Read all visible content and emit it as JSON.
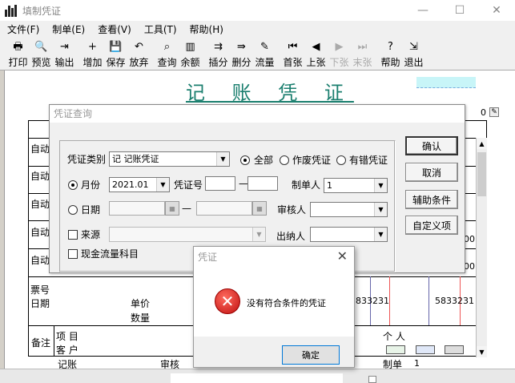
{
  "window": {
    "title": "填制凭证",
    "min": "—",
    "max": "☐",
    "close": "✕"
  },
  "menu": [
    "文件(F)",
    "制单(E)",
    "查看(V)",
    "工具(T)",
    "帮助(H)"
  ],
  "toolbar": [
    {
      "label": "打印",
      "icon": "printer-icon",
      "glyph": "🖶",
      "enabled": true
    },
    {
      "label": "预览",
      "icon": "preview-icon",
      "glyph": "🔍",
      "enabled": true
    },
    {
      "label": "输出",
      "icon": "export-icon",
      "glyph": "⇥",
      "enabled": true
    },
    {
      "label": "增加",
      "icon": "add-icon",
      "glyph": "+",
      "enabled": true
    },
    {
      "label": "保存",
      "icon": "save-icon",
      "glyph": "💾",
      "enabled": true
    },
    {
      "label": "放弃",
      "icon": "undo-icon",
      "glyph": "↶",
      "enabled": true
    },
    {
      "label": "查询",
      "icon": "binoculars-icon",
      "glyph": "⌕",
      "enabled": true
    },
    {
      "label": "余额",
      "icon": "balance-chart-icon",
      "glyph": "▥",
      "enabled": true
    },
    {
      "label": "插分",
      "icon": "insert-row-icon",
      "glyph": "⇉",
      "enabled": true
    },
    {
      "label": "删分",
      "icon": "delete-row-icon",
      "glyph": "⇛",
      "enabled": true
    },
    {
      "label": "流量",
      "icon": "cashflow-icon",
      "glyph": "✎",
      "enabled": true
    },
    {
      "label": "首张",
      "icon": "first-icon",
      "glyph": "⏮",
      "enabled": true
    },
    {
      "label": "上张",
      "icon": "prev-icon",
      "glyph": "◀",
      "enabled": true
    },
    {
      "label": "下张",
      "icon": "next-icon",
      "glyph": "▶",
      "enabled": false
    },
    {
      "label": "末张",
      "icon": "last-icon",
      "glyph": "⏭",
      "enabled": false
    },
    {
      "label": "帮助",
      "icon": "help-icon",
      "glyph": "?",
      "enabled": true
    },
    {
      "label": "退出",
      "icon": "exit-icon",
      "glyph": "⇲",
      "enabled": true
    }
  ],
  "voucher": {
    "title": "记 账 凭 证",
    "right_value": "0",
    "row_labels": [
      "自动",
      "自动",
      "自动",
      "自动",
      "自动"
    ],
    "row_values": [
      "00",
      "00"
    ],
    "ticket_no": "票号",
    "date": "日期",
    "unit_price": "单价",
    "quantity": "数量",
    "amount_debit": "5833231",
    "amount_credit": "5833231",
    "remark": "备注",
    "project": "项    目",
    "customer": "客    户",
    "person": "个    人",
    "bookkeeper": "记账",
    "auditor": "审核",
    "maker_label": "制单",
    "maker_value": "1"
  },
  "query_dialog": {
    "title": "凭证查询",
    "voucher_type_label": "凭证类别",
    "voucher_type_value": "记    记账凭证",
    "radio_all": "全部",
    "radio_void": "作废凭证",
    "radio_error": "有错凭证",
    "month_label": "月份",
    "month_value": "2021.01",
    "voucher_no_label": "凭证号",
    "dash": "—",
    "maker_label": "制单人",
    "maker_value": "1",
    "date_label": "日期",
    "reviewer_label": "审核人",
    "source_label": "来源",
    "cashier_label": "出纳人",
    "cashflow_label": "现金流量科目",
    "btn_ok": "确认",
    "btn_cancel": "取消",
    "btn_aux": "辅助条件",
    "btn_custom": "自定义项"
  },
  "message_box": {
    "title": "凭证",
    "message": "没有符合条件的凭证",
    "ok": "确定"
  }
}
